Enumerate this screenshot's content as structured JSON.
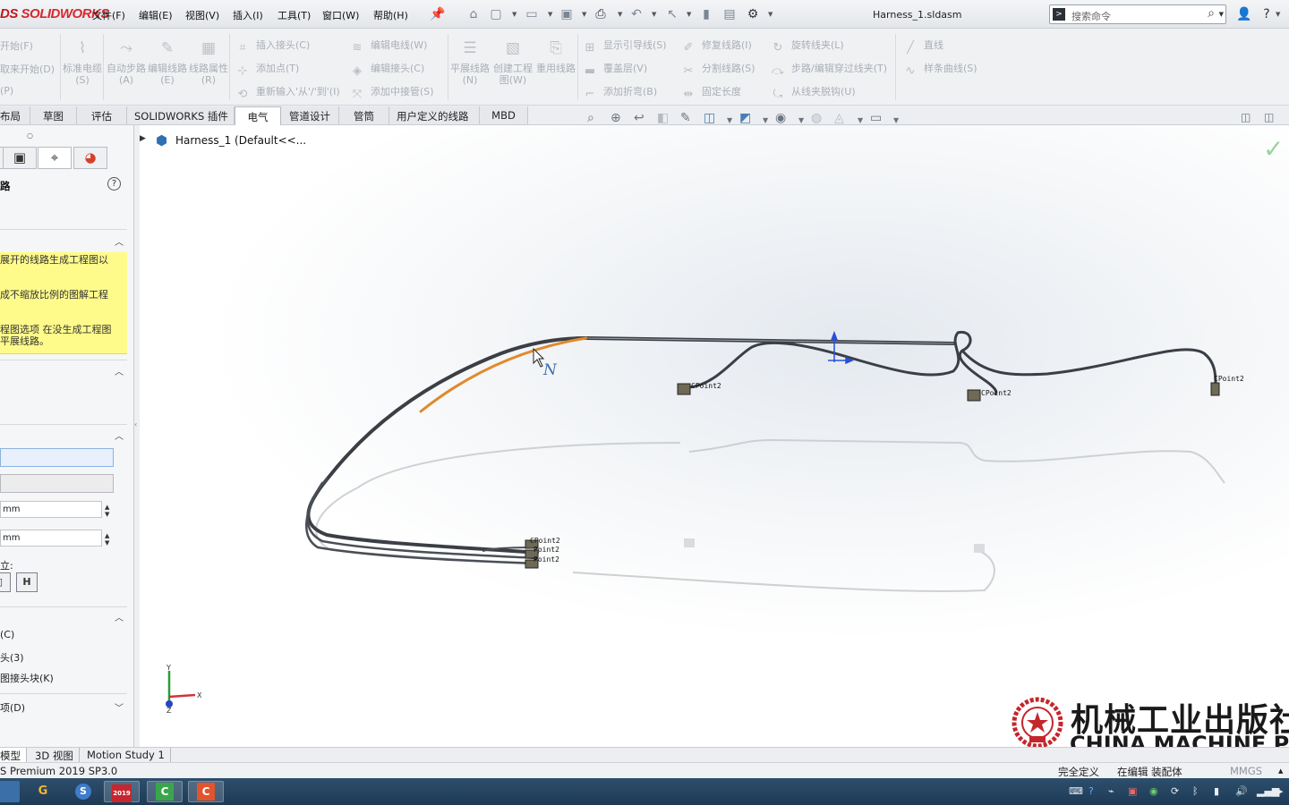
{
  "app": {
    "logo": "SOLIDWORKS",
    "document_title": "Harness_1.sldasm",
    "search_placeholder": "搜索命令"
  },
  "menu": [
    "文件(F)",
    "编辑(E)",
    "视图(V)",
    "插入(I)",
    "工具(T)",
    "窗口(W)",
    "帮助(H)"
  ],
  "command_manager": {
    "left_partial": [
      "开始(F)",
      "取来开始(D)",
      "(P)"
    ],
    "big_buttons": [
      "标准电缆(S)",
      "自动步路(A)",
      "编辑线路(E)",
      "线路属性(R)",
      "平展线路(N)",
      "创建工程图(W)",
      "重用线路"
    ],
    "group1": [
      "插入接头(C)",
      "添加点(T)",
      "重新输入'从'/'到'(I)"
    ],
    "group2": [
      "编辑电线(W)",
      "编辑接头(C)",
      "添加中接管(S)"
    ],
    "group3": [
      "显示引导线(S)",
      "覆盖层(V)",
      "添加折弯(B)"
    ],
    "group4": [
      "修复线路(I)",
      "分割线路(S)",
      "固定长度"
    ],
    "group5": [
      "旋转线夹(L)",
      "步路/编辑穿过线夹(T)",
      "从线夹脱钩(U)"
    ],
    "group6": [
      "直线",
      "样条曲线(S)"
    ]
  },
  "tabs": [
    "布局",
    "草图",
    "评估",
    "SOLIDWORKS 插件",
    "电气",
    "管道设计",
    "管筒",
    "用户定义的线路",
    "MBD"
  ],
  "active_tab": "电气",
  "feature_tree": {
    "root_label": "Harness_1  (Default<<..."
  },
  "property_manager": {
    "title": "路",
    "message_lines": [
      "展开的线路生成工程图以",
      "成不缩放比例的图解工程",
      "程图选项 在没生成工程图",
      "平展线路。"
    ],
    "field1_value": "",
    "field2_value": "",
    "num1": "mm",
    "num2": "mm",
    "position_label": "立:",
    "sq_btn2": "H",
    "opt1": "(C)",
    "opt2": "头(3)",
    "opt3": "图接头块(K)",
    "more_section": "项(D)"
  },
  "graphics": {
    "connector_labels": [
      "CPoint2",
      "CPoint2",
      "CPoint2",
      "CPoint2",
      "Point2",
      "Point2"
    ],
    "triad_x": "X",
    "triad_y": "Y",
    "triad_z": "Z"
  },
  "watermark": {
    "cn": "机械工业出版社",
    "en": "CHINA MACHINE PRESS"
  },
  "model_tabs": [
    "模型",
    "3D 视图",
    "Motion Study 1"
  ],
  "status": {
    "product": "S Premium 2019 SP3.0",
    "definition": "完全定义",
    "mode": "在编辑 装配体",
    "units": "MMGS"
  },
  "taskbar": {
    "apps": [
      "G",
      "S",
      "2019",
      "C",
      "C"
    ]
  },
  "colors": {
    "selected_route": "#e08a2c",
    "route": "#3b3f45",
    "message_bg": "#fffb8a",
    "taskbar": "#1f3c58"
  }
}
